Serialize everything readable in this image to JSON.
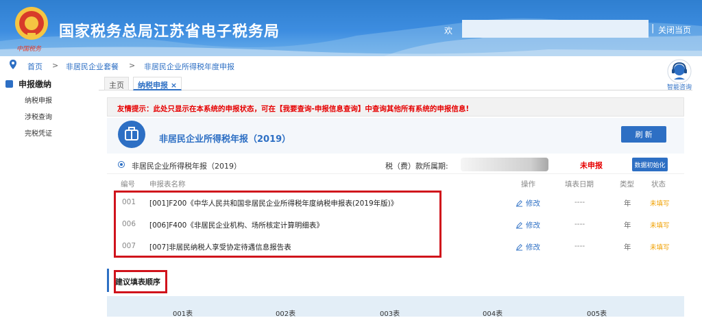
{
  "header": {
    "title": "国家税务总局江苏省电子税务局",
    "emblem_text": "中国税务",
    "welcome": "欢",
    "separator": "|",
    "close_home": "关闭当页"
  },
  "breadcrumb": [
    "首页",
    ">",
    "非居民企业套餐",
    ">",
    "非居民企业所得税年度申报"
  ],
  "sidebar": {
    "heading": "申报缴纳",
    "items": [
      "纳税申报",
      "涉税查询",
      "完税凭证"
    ]
  },
  "tabs": [
    {
      "label": "主页"
    },
    {
      "label": "纳税申报 ×"
    }
  ],
  "helper": {
    "label": "智能咨询"
  },
  "notice": "友情提示：此处只显示在本系统的申报状态，可在【我要查询-申报信息查询】中查询其他所有系统的申报信息!",
  "report": {
    "title": "非居民企业所得税年报（2019）",
    "refresh": "刷 新",
    "form_name": "非居民企业所得税年报（2019）",
    "period_label": "税（费）款所属期:",
    "status": "未申报",
    "init_button": "数据初始化"
  },
  "table": {
    "headers": [
      "编号",
      "申报表名称",
      "操作",
      "填表日期",
      "类型",
      "状态"
    ],
    "rows": [
      {
        "no": "001",
        "name": "[001]F200《中华人民共和国非居民企业所得税年度纳税申报表(2019年版)》",
        "action": "修改",
        "date": "----",
        "type": "年",
        "status": "未填写"
      },
      {
        "no": "006",
        "name": "[006]F400《非居民企业机构、场所核定计算明细表》",
        "action": "修改",
        "date": "----",
        "type": "年",
        "status": "未填写"
      },
      {
        "no": "007",
        "name": "[007]非居民纳税人享受协定待遇信息报告表",
        "action": "修改",
        "date": "----",
        "type": "年",
        "status": "未填写"
      }
    ]
  },
  "order": {
    "title": "建议填表顺序",
    "steps": [
      "001表",
      "002表",
      "003表",
      "004表",
      "005表"
    ]
  },
  "colors": {
    "primary": "#2d6fc4",
    "alert": "#e60000",
    "highlight": "#d0121b",
    "pending": "#f0a000"
  }
}
